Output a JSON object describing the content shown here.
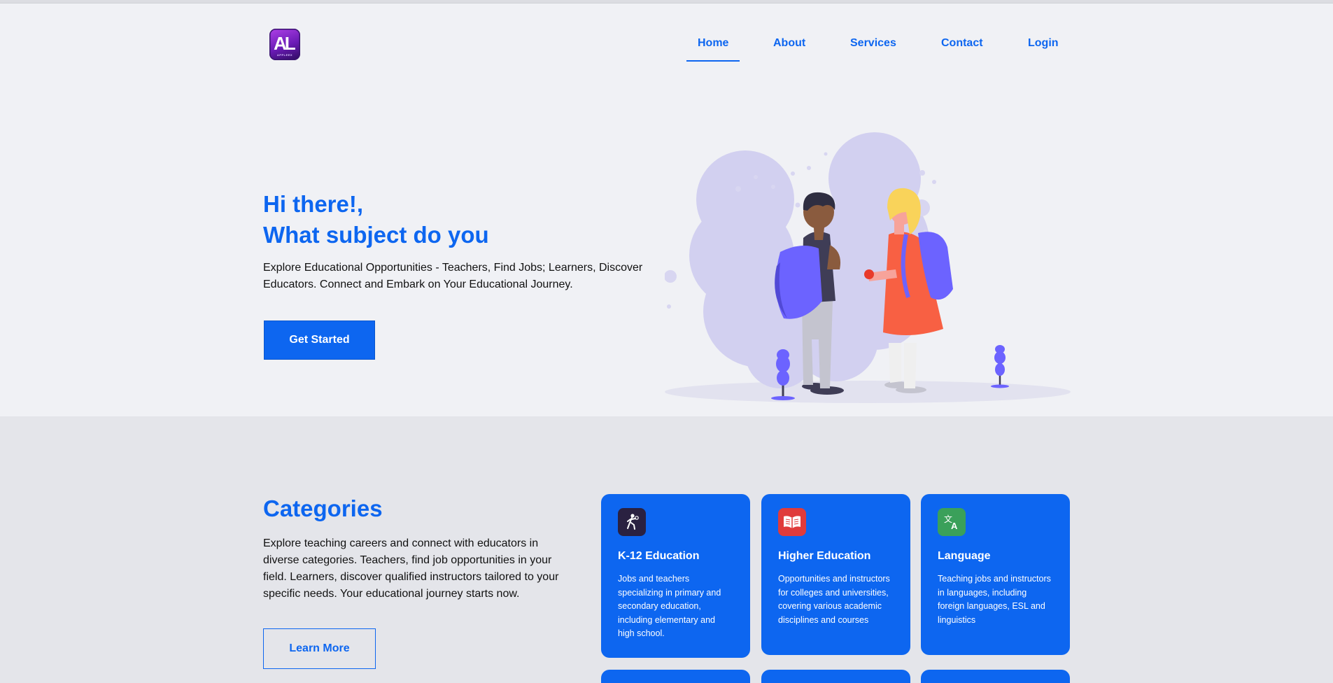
{
  "brand": {
    "logo_letters": "AL",
    "logo_subtext": "APPLEEX"
  },
  "nav": {
    "items": [
      {
        "label": "Home",
        "active": true
      },
      {
        "label": "About"
      },
      {
        "label": "Services"
      },
      {
        "label": "Contact"
      },
      {
        "label": "Login"
      }
    ]
  },
  "hero": {
    "greeting_line1": "Hi there!,",
    "greeting_line2": "What subject do you",
    "description": "Explore Educational Opportunities - Teachers, Find Jobs; Learners, Discover Educators. Connect and Embark on Your Educational Journey.",
    "cta_label": "Get Started"
  },
  "categories": {
    "title": "Categories",
    "description": "Explore teaching careers and connect with educators in diverse categories. Teachers, find job opportunities in your field. Learners, discover qualified instructors tailored to your specific needs. Your educational journey starts now.",
    "learn_more_label": "Learn More",
    "cards": [
      {
        "icon": "school-kid-icon",
        "icon_color": "#2a2141",
        "title": "K-12 Education",
        "text": "Jobs and teachers specializing in primary and secondary education, including elementary and high school."
      },
      {
        "icon": "open-book-icon",
        "icon_color": "#e03b3b",
        "title": "Higher Education",
        "text": "Opportunities and instructors for colleges and universities, covering various academic disciplines and courses"
      },
      {
        "icon": "translate-icon",
        "icon_color": "#3aa05a",
        "title": "Language",
        "text": "Teaching jobs and instructors in languages, including foreign languages, ESL and linguistics"
      }
    ]
  },
  "colors": {
    "accent": "#0d66f0",
    "hero_bg": "#f0f1f5",
    "section_bg": "#e4e5ea"
  }
}
